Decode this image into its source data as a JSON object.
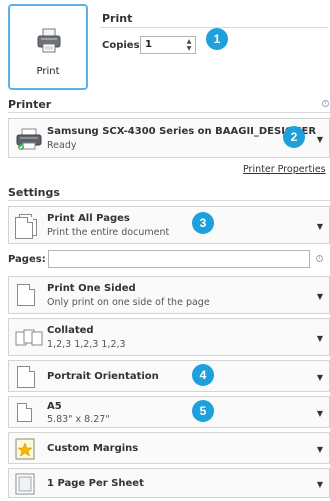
{
  "print": {
    "button_label": "Print",
    "title": "Print",
    "copies_label": "Copies:",
    "copies_value": "1"
  },
  "badges": [
    "1",
    "2",
    "3",
    "4",
    "5"
  ],
  "printer": {
    "section_title": "Printer",
    "name": "Samsung SCX-4300 Series on BAAGII_DESIGNER",
    "status": "Ready",
    "properties_link": "Printer Properties"
  },
  "settings": {
    "section_title": "Settings",
    "pages_label": "Pages:",
    "pages_value": "",
    "options": [
      {
        "main": "Print All Pages",
        "sub": "Print the entire document"
      },
      {
        "main": "Print One Sided",
        "sub": "Only print on one side of the page"
      },
      {
        "main": "Collated",
        "sub": "1,2,3   1,2,3   1,2,3"
      },
      {
        "main": "Portrait Orientation",
        "sub": ""
      },
      {
        "main": "A5",
        "sub": "5.83\" x 8.27\""
      },
      {
        "main": "Custom Margins",
        "sub": ""
      },
      {
        "main": "1 Page Per Sheet",
        "sub": ""
      }
    ]
  },
  "colors": {
    "accent": "#1ea0dc",
    "print_button_border": "#5fb2e8"
  }
}
